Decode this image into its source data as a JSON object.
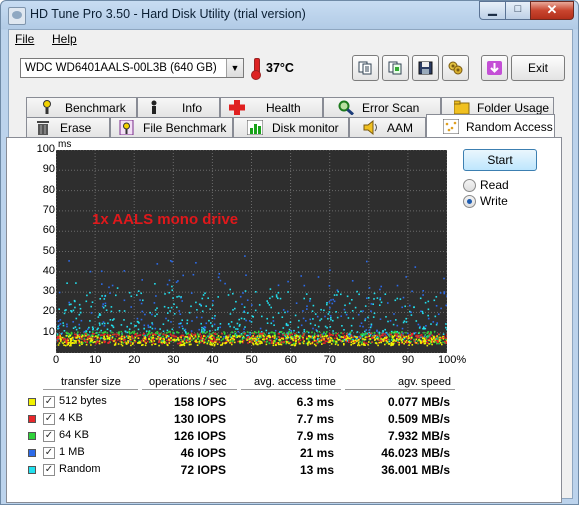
{
  "window": {
    "title": "HD Tune Pro 3.50 - Hard Disk Utility (trial version)"
  },
  "menu": [
    {
      "label": "File"
    },
    {
      "label": "Help"
    }
  ],
  "toolbar": {
    "drive": "WDC WD6401AALS-00L3B (640 GB)",
    "temperature": "37°C",
    "buttons": [
      "copy-text-icon",
      "copy-screenshot-icon",
      "save-icon",
      "options-icon",
      "download-icon"
    ],
    "exit_label": "Exit"
  },
  "tabs_back": [
    "Benchmark",
    "Info",
    "Health",
    "Error Scan",
    "Folder Usage"
  ],
  "tabs_front": [
    "Erase",
    "File Benchmark",
    "Disk monitor",
    "AAM",
    "Random Access"
  ],
  "active_tab": "Random Access",
  "controls": {
    "start_label": "Start",
    "read_label": "Read",
    "write_label": "Write",
    "selected": "Write"
  },
  "chart_data": {
    "type": "scatter",
    "title": "",
    "annotation": "1x AALS mono drive",
    "ylabel": "ms",
    "xlabel": "",
    "ylim": [
      0,
      100
    ],
    "xlim": [
      0,
      100
    ],
    "yticks": [
      "100",
      "90",
      "80",
      "70",
      "60",
      "50",
      "40",
      "30",
      "20",
      "10"
    ],
    "xticks": [
      "0",
      "10",
      "20",
      "30",
      "40",
      "50",
      "60",
      "70",
      "80",
      "90",
      "100%"
    ],
    "background": "#2e2e2e",
    "grid": true,
    "series": [
      {
        "name": "512 bytes",
        "color": "#f2f200",
        "band_ms": [
          4,
          9
        ],
        "avg_ms": 6.3
      },
      {
        "name": "4 KB",
        "color": "#e8262a",
        "band_ms": [
          5,
          10
        ],
        "avg_ms": 7.7
      },
      {
        "name": "64 KB",
        "color": "#2fd23a",
        "band_ms": [
          5,
          11
        ],
        "avg_ms": 7.9
      },
      {
        "name": "1 MB",
        "color": "#2c6bea",
        "band_ms": [
          8,
          45
        ],
        "avg_ms": 21
      },
      {
        "name": "Random",
        "color": "#22e0ee",
        "band_ms": [
          6,
          30
        ],
        "avg_ms": 13
      }
    ]
  },
  "results": {
    "headers": [
      "transfer size",
      "operations / sec",
      "avg. access time",
      "agv. speed"
    ],
    "rows": [
      {
        "size": "512 bytes",
        "color": "#f2f200",
        "ops": "158 IOPS",
        "access": "6.3 ms",
        "speed": "0.077 MB/s"
      },
      {
        "size": "4 KB",
        "color": "#e8262a",
        "ops": "130 IOPS",
        "access": "7.7 ms",
        "speed": "0.509 MB/s"
      },
      {
        "size": "64 KB",
        "color": "#2fd23a",
        "ops": "126 IOPS",
        "access": "7.9 ms",
        "speed": "7.932 MB/s"
      },
      {
        "size": "1 MB",
        "color": "#2c6bea",
        "ops": "46 IOPS",
        "access": "21 ms",
        "speed": "46.023 MB/s"
      },
      {
        "size": "Random",
        "color": "#22e0ee",
        "ops": "72 IOPS",
        "access": "13 ms",
        "speed": "36.001 MB/s"
      }
    ]
  }
}
